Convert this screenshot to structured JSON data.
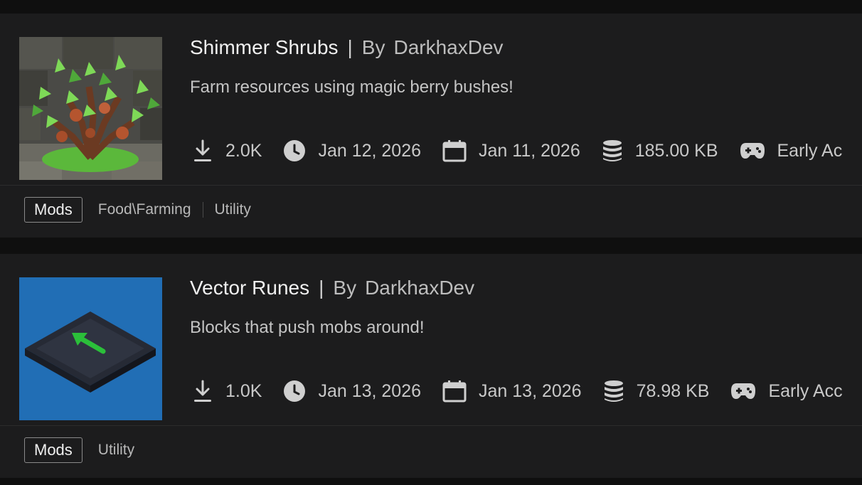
{
  "projects": [
    {
      "title": "Shimmer Shrubs",
      "by_label": "By",
      "author": "DarkhaxDev",
      "description": "Farm resources using magic berry bushes!",
      "downloads": "2.0K",
      "updated": "Jan 12, 2026",
      "created": "Jan 11, 2026",
      "size": "185.00 KB",
      "stage": "Early Ac",
      "primary_tag": "Mods",
      "tags": [
        "Food\\Farming",
        "Utility"
      ]
    },
    {
      "title": "Vector Runes",
      "by_label": "By",
      "author": "DarkhaxDev",
      "description": "Blocks that push mobs around!",
      "downloads": "1.0K",
      "updated": "Jan 13, 2026",
      "created": "Jan 13, 2026",
      "size": "78.98 KB",
      "stage": "Early Acc",
      "primary_tag": "Mods",
      "tags": [
        "Utility"
      ]
    }
  ],
  "icons": {
    "downloads": "download-icon",
    "updated": "clock-icon",
    "created": "calendar-icon",
    "size": "database-icon",
    "stage": "gamepad-icon"
  },
  "colors": {
    "background": "#0f0f0f",
    "card": "#1c1c1d",
    "text": "#d6d6d6",
    "accent_green": "#2bbf3a"
  }
}
